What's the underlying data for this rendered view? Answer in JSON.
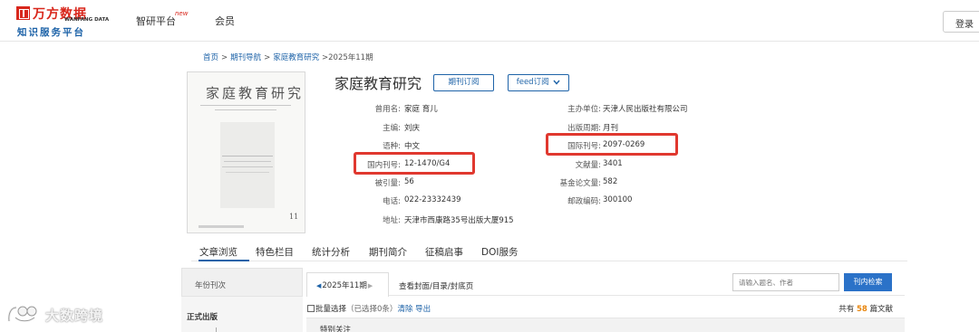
{
  "header": {
    "logo_cn": "万方数据",
    "logo_en": "WANFANG DATA",
    "logo_sub": "知识服务平台",
    "nav": [
      {
        "label": "智研平台",
        "badge": "new"
      },
      {
        "label": "会员"
      }
    ],
    "login_label": "登录"
  },
  "breadcrumb": {
    "items": [
      "首页",
      "期刊导航",
      "家庭教育研究"
    ],
    "current": ">2025年11期"
  },
  "cover": {
    "title": "家庭教育研究",
    "issue_number": "11"
  },
  "journal": {
    "title": "家庭教育研究",
    "subscribe_label": "期刊订阅",
    "feed_label": "feed订阅"
  },
  "info": {
    "former_name_label": "曾用名:",
    "former_name_value": "家庭 育儿",
    "editor_label": "主编:",
    "editor_value": "刘庆",
    "language_label": "语种:",
    "language_value": "中文",
    "cn_label": "国内刊号:",
    "cn_value": "12-1470/G4",
    "cited_label": "被引量:",
    "cited_value": "56",
    "phone_label": "电话:",
    "phone_value": "022-23332439",
    "address_label": "地址:",
    "address_value": "天津市西康路35号出版大厦915",
    "sponsor_label": "主办单位:",
    "sponsor_value": "天津人民出版社有限公司",
    "cycle_label": "出版周期:",
    "cycle_value": "月刊",
    "issn_label": "国际刊号:",
    "issn_value": "2097-0269",
    "docs_label": "文献量:",
    "docs_value": "3401",
    "fund_label": "基金论文量:",
    "fund_value": "582",
    "postcode_label": "邮政编码:",
    "postcode_value": "300100"
  },
  "tabs": [
    "文章浏览",
    "特色栏目",
    "统计分析",
    "期刊简介",
    "征稿启事",
    "DOI服务"
  ],
  "left_panel": {
    "year_label": "年份刊次",
    "formal_label": "正式出版"
  },
  "issue_bar": {
    "issue_label": "2025年11期",
    "view_cover_label": "查看封面/目录/封底页",
    "search_placeholder": "请输入题名、作者",
    "search_button": "刊内检索"
  },
  "batch": {
    "label": "批量选择",
    "count": "（已选择0条）",
    "clear": "清除",
    "export": "导出",
    "total_prefix": "共有",
    "total_num": "58",
    "total_suffix": "篇文献"
  },
  "special": {
    "label": "特别关注"
  },
  "watermark": {
    "text": "大数跨境"
  },
  "colors": {
    "brand_red": "#d8261b",
    "link_blue": "#1e63a8",
    "highlight": "#e0382f",
    "count_orange": "#e8860e"
  }
}
